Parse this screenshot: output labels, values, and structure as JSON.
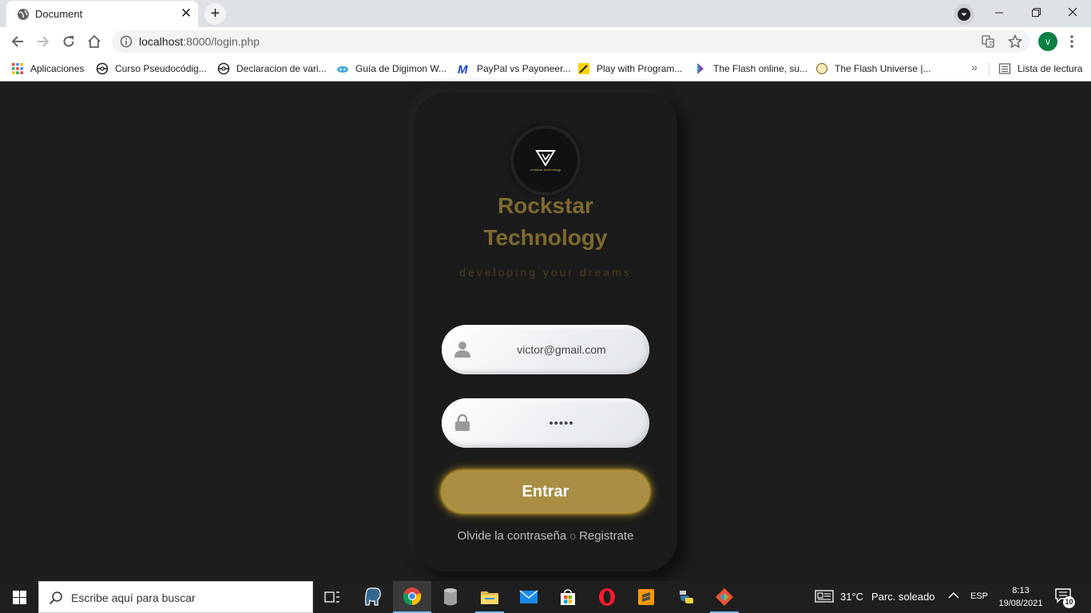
{
  "browser": {
    "tab_title": "Document",
    "url_host": "localhost",
    "url_rest": ":8000/login.php",
    "profile_initial": "v",
    "bookmarks": [
      {
        "label": "Aplicaciones",
        "icon": "apps-grid-icon"
      },
      {
        "label": "Curso Pseudocódig...",
        "icon": "site-icon"
      },
      {
        "label": "Declaracion de vari...",
        "icon": "site-icon"
      },
      {
        "label": "Guía de Digimon W...",
        "icon": "site-icon"
      },
      {
        "label": "PayPal vs Payoneer...",
        "icon": "site-icon"
      },
      {
        "label": "Play with Program...",
        "icon": "site-icon"
      },
      {
        "label": "The Flash online, su...",
        "icon": "site-icon"
      },
      {
        "label": "The Flash Universe |...",
        "icon": "site-icon"
      }
    ],
    "reading_list": "Lista de lectura"
  },
  "login": {
    "logo_text": "rockstar technology",
    "brand_line1": "Rockstar",
    "brand_line2": "Technology",
    "slogan": "developing your dreams",
    "email_value": "victor@gmail.com",
    "password_value": "•••••",
    "submit_label": "Entrar",
    "forgot_label": "Olvide la contraseña",
    "separator": "o",
    "register_label": "Registrate",
    "accent_color": "#a98e44",
    "brand_color": "#7d6a2e"
  },
  "taskbar": {
    "search_placeholder": "Escribe aquí para buscar",
    "weather_temp": "31°C",
    "weather_condition": "Parc. soleado",
    "language": "ESP",
    "time": "8:13",
    "date": "19/08/2021",
    "notification_count": "10"
  }
}
